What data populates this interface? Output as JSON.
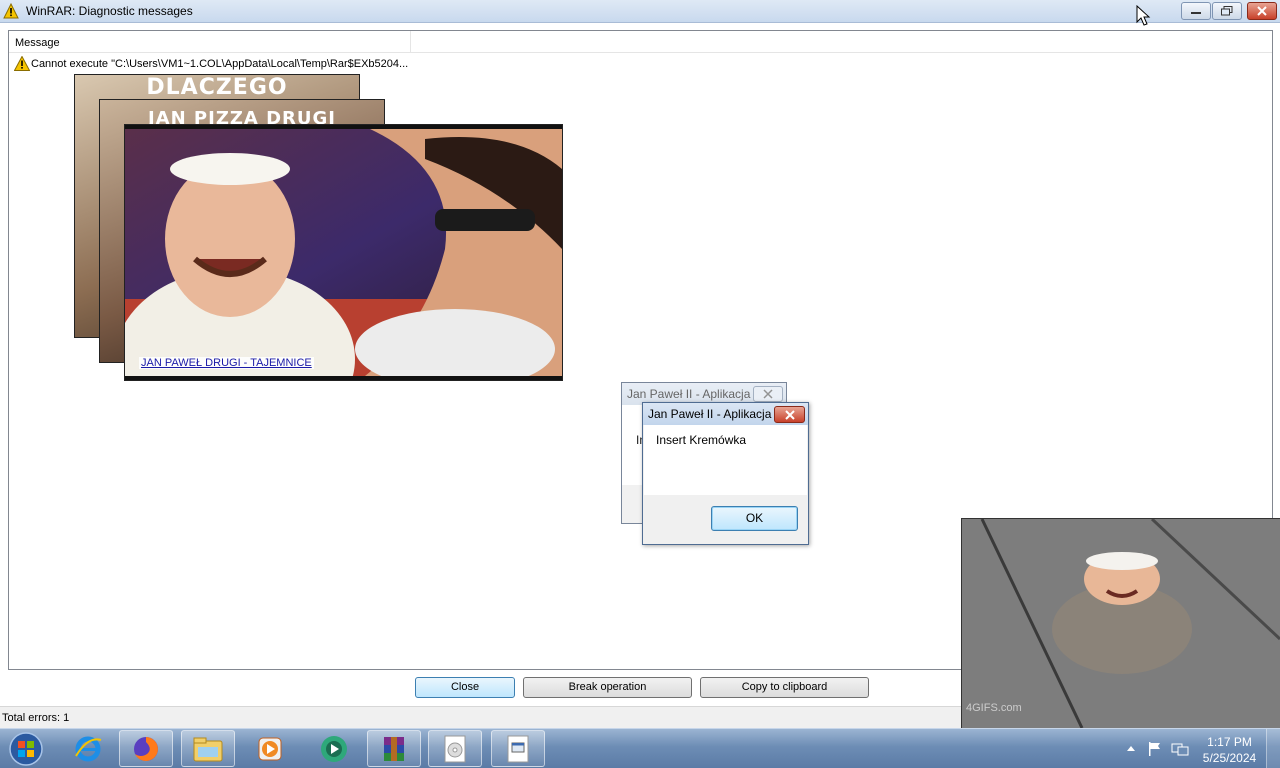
{
  "window": {
    "title": "WinRAR: Diagnostic messages",
    "buttons": {
      "minimize": "minimize",
      "maximize": "maximize",
      "close": "close"
    }
  },
  "list": {
    "column_header": "Message",
    "rows": [
      {
        "icon": "warning-icon",
        "text": "Cannot execute \"C:\\Users\\VM1~1.COL\\AppData\\Local\\Temp\\Rar$EXb5204..."
      }
    ]
  },
  "overlays": {
    "image1_banner": "DLACZEGO",
    "image2_banner": "JAN PIZZA DRUGI",
    "image3_link": "JAN PAWEŁ DRUGI - TAJEMNICE",
    "gif_watermark": "4GIFS.com"
  },
  "dialog_back": {
    "title": "Jan Paweł II - Aplikacja",
    "fragment": "In"
  },
  "dialog_front": {
    "title": "Jan Paweł II - Aplikacja",
    "message": "Insert Kremówka",
    "ok": "OK"
  },
  "buttons": {
    "close": "Close",
    "break": "Break operation",
    "copy": "Copy to clipboard"
  },
  "status": {
    "total_errors": "Total errors: 1"
  },
  "taskbar": {
    "time": "1:17 PM",
    "date": "5/25/2024",
    "items": [
      "internet-explorer-icon",
      "firefox-icon",
      "file-explorer-icon",
      "media-player-icon",
      "media-center-icon",
      "winrar-icon",
      "cd-image-icon",
      "exe-file-icon"
    ]
  },
  "colors": {
    "titlebar": "#c8d9ee",
    "taskbar": "#6d8db5",
    "accent_button": "#bee6fd",
    "close_red": "#c8412a"
  }
}
